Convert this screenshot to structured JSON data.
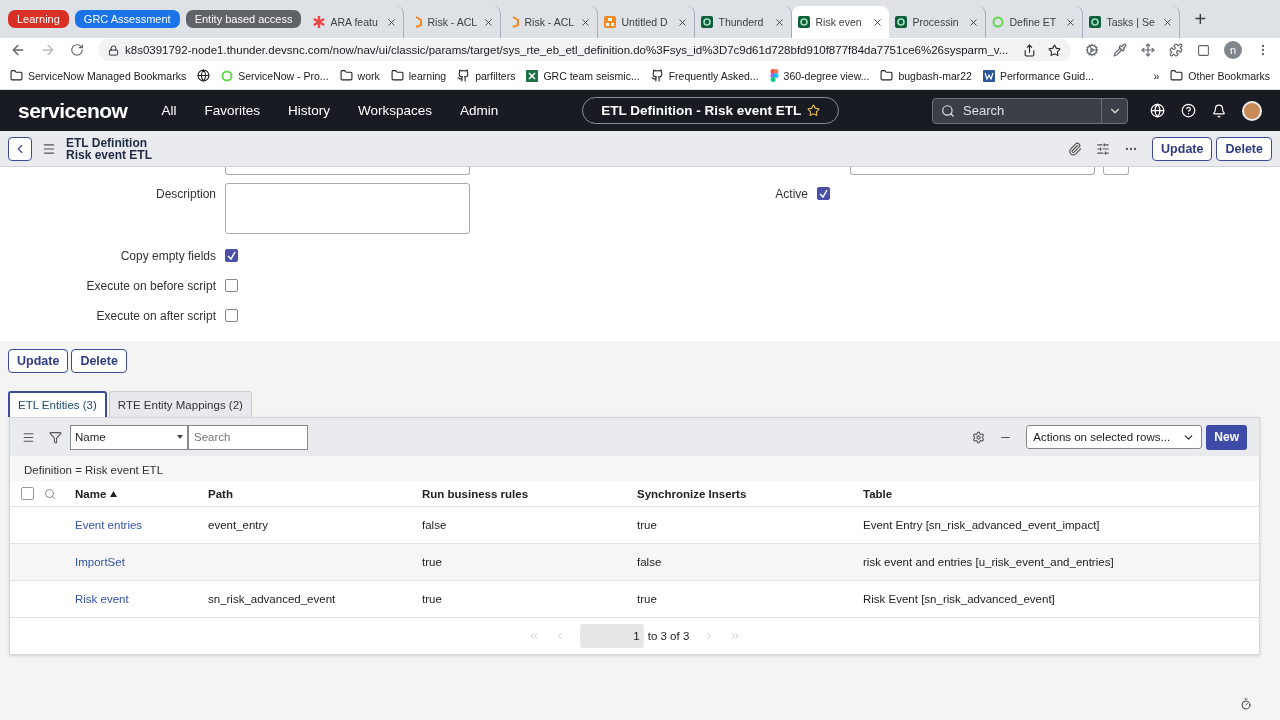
{
  "browser": {
    "tab_groups": [
      {
        "label": "Learning",
        "color": "#d93025"
      },
      {
        "label": "GRC Assessment",
        "color": "#1a73e8"
      },
      {
        "label": "Entity based access",
        "color": "#5f6368"
      }
    ],
    "tabs": [
      {
        "title": "ARA featu",
        "kind": "asterisk",
        "selected": false
      },
      {
        "title": "Risk - ACL",
        "kind": "hex",
        "selected": false
      },
      {
        "title": "Risk - ACL",
        "kind": "hex",
        "selected": false
      },
      {
        "title": "Untitled D",
        "kind": "diagram",
        "selected": false
      },
      {
        "title": "Thunderd",
        "kind": "sn",
        "selected": false
      },
      {
        "title": "Risk even",
        "kind": "sn",
        "selected": true
      },
      {
        "title": "Processin",
        "kind": "sn",
        "selected": false
      },
      {
        "title": "Define ET",
        "kind": "ring",
        "selected": false
      },
      {
        "title": "Tasks | Se",
        "kind": "sn",
        "selected": false
      }
    ],
    "new_tab": "+",
    "url": "k8s0391792-node1.thunder.devsnc.com/now/nav/ui/classic/params/target/sys_rte_eb_etl_definition.do%3Fsys_id%3D7c9d61d728bfd910f877f84da7751ce6%26sysparm_v...",
    "profile_letter": "n",
    "bookmarks": [
      {
        "label": "ServiceNow Managed Bookmarks",
        "kind": "folder"
      },
      {
        "kind": "globe"
      },
      {
        "label": "ServiceNow - Pro...",
        "kind": "ring"
      },
      {
        "label": "work",
        "kind": "folder"
      },
      {
        "label": "learning",
        "kind": "folder"
      },
      {
        "label": "parfilters",
        "kind": "github"
      },
      {
        "label": "GRC team seismic...",
        "kind": "excel"
      },
      {
        "label": "Frequently Asked...",
        "kind": "github"
      },
      {
        "label": "360-degree view...",
        "kind": "figma"
      },
      {
        "label": "bugbash-mar22",
        "kind": "folder"
      },
      {
        "label": "Performance Guid...",
        "kind": "word"
      }
    ],
    "more": "»",
    "other_bookmarks": "Other Bookmarks"
  },
  "header": {
    "logo": "servicenow",
    "nav": [
      "All",
      "Favorites",
      "History",
      "Workspaces",
      "Admin"
    ],
    "context": "ETL Definition - Risk event ETL",
    "search": {
      "placeholder": "Search"
    }
  },
  "form_header": {
    "title": "ETL Definition",
    "subtitle": "Risk event ETL",
    "buttons": [
      "Update",
      "Delete"
    ]
  },
  "form": {
    "fields": [
      {
        "label": "Description",
        "kind": "textarea"
      },
      {
        "label": "Copy empty fields",
        "kind": "checkbox",
        "checked": true
      },
      {
        "label": "Execute on before script",
        "kind": "checkbox",
        "checked": false
      },
      {
        "label": "Execute on after script",
        "kind": "checkbox",
        "checked": false
      }
    ],
    "active": {
      "label": "Active",
      "checked": true
    }
  },
  "form_buttons": [
    "Update",
    "Delete"
  ],
  "related_tabs": [
    {
      "label": "ETL Entities (3)",
      "selected": true
    },
    {
      "label": "RTE Entity Mappings (2)",
      "selected": false
    }
  ],
  "list": {
    "filter_field": "Name",
    "search": {
      "placeholder": "Search"
    },
    "actions": "Actions on selected rows...",
    "new_button": "New",
    "breadcrumb": "Definition = Risk event ETL",
    "select_all": {
      "checked": false
    },
    "columns": [
      {
        "label": "Name",
        "sorted": true
      },
      {
        "label": "Path",
        "sorted": false
      },
      {
        "label": "Run business rules",
        "sorted": false
      },
      {
        "label": "Synchronize Inserts",
        "sorted": false
      },
      {
        "label": "Table",
        "sorted": false
      }
    ],
    "rows": [
      [
        "Event entries",
        "event_entry",
        "false",
        "true",
        "Event Entry [sn_risk_advanced_event_impact]"
      ],
      [
        "ImportSet",
        "",
        "true",
        "false",
        "risk event and entries [u_risk_event_and_entries]"
      ],
      [
        "Risk event",
        "sn_risk_advanced_event",
        "true",
        "true",
        "Risk Event [sn_risk_advanced_event]"
      ]
    ],
    "pagination": {
      "page": "1",
      "range": "to 3 of 3"
    }
  }
}
